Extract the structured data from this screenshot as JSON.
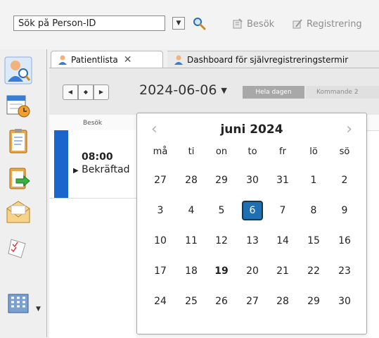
{
  "toolbar": {
    "search_value": "Sök på Person-ID",
    "visit_label": "Besök",
    "registration_label": "Registrering"
  },
  "tabs": [
    {
      "label": "Patientlista",
      "close": "✕"
    },
    {
      "label": "Dashboard för självregistreringstermir"
    }
  ],
  "date_bar": {
    "date": "2024-06-06",
    "nav_prev": "◀",
    "nav_today": "◆",
    "nav_next": "▶",
    "caret": "▼",
    "segment_all_day": "Hela dagen",
    "segment_upcoming": "Kommande 2"
  },
  "list": {
    "column_header": "Besök",
    "rows": [
      {
        "time": "08:00",
        "status": "Bekräftad",
        "status_marker": "▶",
        "status_color": "#1a66cc"
      }
    ]
  },
  "calendar": {
    "title": "juni 2024",
    "prev": "‹",
    "next": "›",
    "weekdays": [
      "må",
      "ti",
      "on",
      "to",
      "fr",
      "lö",
      "sö"
    ],
    "weeks": [
      [
        "27",
        "28",
        "29",
        "30",
        "31",
        "1",
        "2"
      ],
      [
        "3",
        "4",
        "5",
        "6",
        "7",
        "8",
        "9"
      ],
      [
        "10",
        "11",
        "12",
        "13",
        "14",
        "15",
        "16"
      ],
      [
        "17",
        "18",
        "19",
        "20",
        "21",
        "22",
        "23"
      ],
      [
        "24",
        "25",
        "26",
        "27",
        "28",
        "29",
        "30"
      ]
    ],
    "selected_day": "6",
    "bold_day": "19",
    "selected_color": "#1f6fb2"
  },
  "rail_icons": [
    "patient-search-icon",
    "calendar-clock-icon",
    "clipboard-icon",
    "transfer-icon",
    "mail-icon",
    "checklist-icon",
    "building-icon"
  ]
}
